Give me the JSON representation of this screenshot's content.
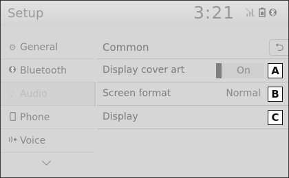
{
  "header": {
    "title": "Setup",
    "clock": "3:21"
  },
  "status": {
    "icons": [
      "signal-icon",
      "battery-icon",
      "bluetooth-icon"
    ]
  },
  "sidebar": {
    "items": [
      {
        "label": "General",
        "icon": "gear-icon"
      },
      {
        "label": "Bluetooth",
        "icon": "bluetooth-icon"
      },
      {
        "label": "Audio",
        "icon": "music-note-icon",
        "active": true
      },
      {
        "label": "Phone",
        "icon": "phone-icon"
      },
      {
        "label": "Voice",
        "icon": "voice-icon"
      }
    ],
    "more_icon": "chevron-down-icon"
  },
  "main": {
    "section_label": "Common",
    "back_icon": "back-arrow-icon",
    "rows": [
      {
        "label": "Display cover art",
        "value": "On",
        "callout": "A"
      },
      {
        "label": "Screen format",
        "value": "Normal",
        "callout": "B"
      },
      {
        "label": "Display",
        "callout": "C"
      }
    ]
  }
}
